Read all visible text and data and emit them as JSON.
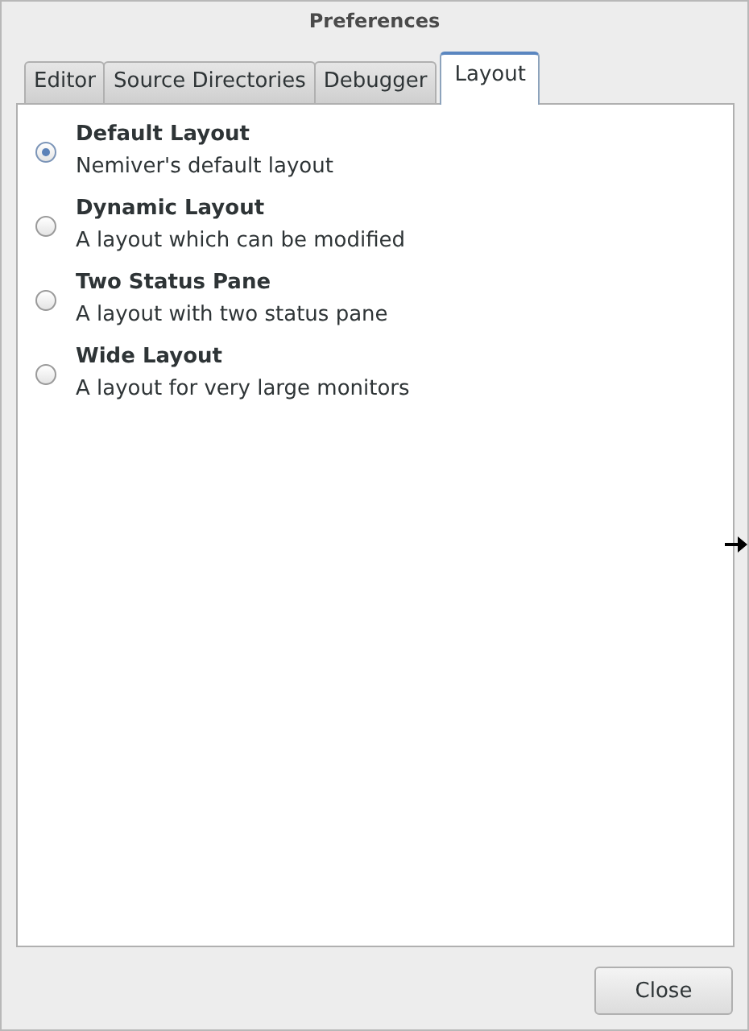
{
  "window": {
    "title": "Preferences"
  },
  "tabs": [
    {
      "label": "Editor",
      "selected": false
    },
    {
      "label": "Source Directories",
      "selected": false
    },
    {
      "label": "Debugger",
      "selected": false
    },
    {
      "label": "Layout",
      "selected": true
    }
  ],
  "layouts": [
    {
      "title": "Default Layout",
      "description": "Nemiver's default layout",
      "selected": true
    },
    {
      "title": "Dynamic Layout",
      "description": "A layout which can be modified",
      "selected": false
    },
    {
      "title": "Two Status Pane",
      "description": "A layout with two status pane",
      "selected": false
    },
    {
      "title": "Wide Layout",
      "description": "A layout for very large monitors",
      "selected": false
    }
  ],
  "buttons": [
    "Close"
  ]
}
